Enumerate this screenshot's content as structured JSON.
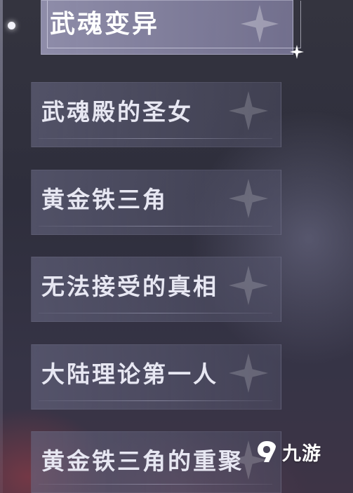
{
  "active_chapter": {
    "label": "武魂变异"
  },
  "chapters": [
    {
      "label": "武魂殿的圣女"
    },
    {
      "label": "黄金铁三角"
    },
    {
      "label": "无法接受的真相"
    },
    {
      "label": "大陆理论第一人"
    },
    {
      "label": "黄金铁三角的重聚"
    }
  ],
  "watermark": {
    "text": "九游",
    "icon": "nine-game-logo-icon"
  }
}
